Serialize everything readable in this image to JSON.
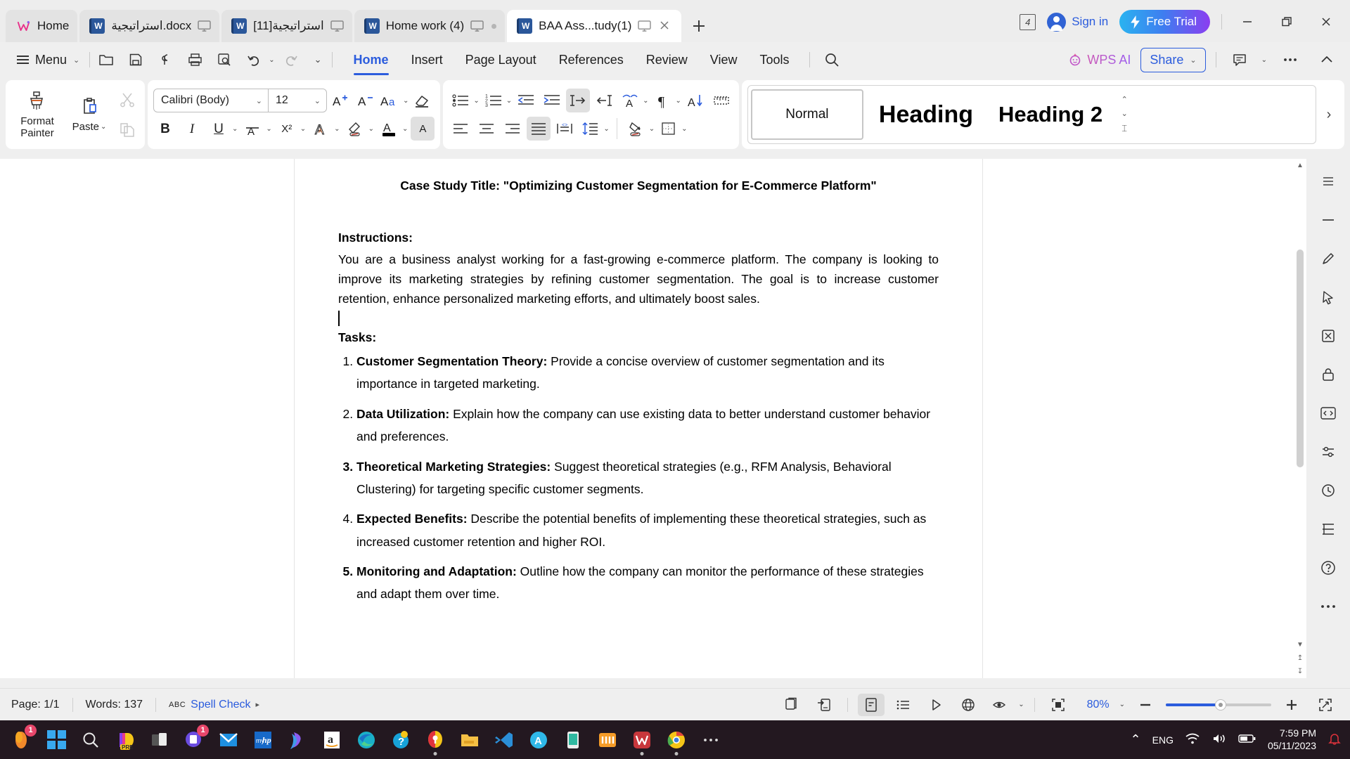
{
  "window": {
    "tabs": [
      {
        "label": "Home",
        "icon": "wps-home-icon",
        "type": "home",
        "active": false,
        "has_monitor": false,
        "has_close": false
      },
      {
        "label": "استراتيجية.docx",
        "icon": "word-doc-icon",
        "type": "doc",
        "active": false,
        "has_monitor": true,
        "has_close": false
      },
      {
        "label": "استراتيجية[11]",
        "icon": "word-doc-icon",
        "type": "doc",
        "active": false,
        "has_monitor": true,
        "has_close": false
      },
      {
        "label": "Home work (4)",
        "icon": "word-doc-icon",
        "type": "doc",
        "active": false,
        "has_monitor": true,
        "has_close": false,
        "has_dot": true
      },
      {
        "label": "BAA Ass...tudy(1)",
        "icon": "word-doc-icon",
        "type": "doc",
        "active": true,
        "has_monitor": true,
        "has_close": true
      }
    ],
    "new_tab_label": "+",
    "window_count_badge": "4",
    "sign_in_label": "Sign in",
    "free_trial_label": "Free Trial",
    "minimize_label": "—",
    "restore_label": "❐",
    "close_label": "✕",
    "accent_blue": "#2b5cdd"
  },
  "menubar": {
    "menu_label": "Menu",
    "quick_access": [
      "open-folder-icon",
      "save-icon",
      "cloud-sync-icon",
      "print-icon",
      "print-preview-icon",
      "undo-icon",
      "redo-icon",
      "customize-icon"
    ],
    "ribbon_tabs": [
      {
        "label": "Home",
        "active": true
      },
      {
        "label": "Insert",
        "active": false
      },
      {
        "label": "Page Layout",
        "active": false
      },
      {
        "label": "References",
        "active": false
      },
      {
        "label": "Review",
        "active": false
      },
      {
        "label": "View",
        "active": false
      },
      {
        "label": "Tools",
        "active": false
      }
    ],
    "search_icon": "search-icon",
    "wps_ai_label": "WPS AI",
    "share_label": "Share",
    "comment_icon": "comment-icon",
    "more_icon": "more-icon",
    "collapse_icon": "chevron-up-icon"
  },
  "toolbar": {
    "format_painter_label": "Format Painter",
    "paste_label": "Paste",
    "cut_label": "cut-icon",
    "copy_label": "copy-icon",
    "font_name": "Calibri (Body)",
    "font_size": "12",
    "grow_font": "A+",
    "shrink_font": "A-",
    "change_case": "Aa",
    "clear_format": "clear-formatting-icon",
    "bold": "B",
    "italic": "I",
    "underline": "U",
    "strikethrough": "A",
    "superscript": "X²",
    "text_effects": "A",
    "highlight": "highlight-icon",
    "font_color": "A",
    "char_shading": "A",
    "bullets": "bullet-list-icon",
    "numbering": "numbered-list-icon",
    "decrease_indent": "decrease-indent-icon",
    "increase_indent": "increase-indent-icon",
    "ltr_text": "left-to-right-icon",
    "rtl_text": "right-to-left-icon",
    "phonetic": "phonetic-guide-icon",
    "show_marks": "show-paragraph-marks-icon",
    "sort": "sort-icon",
    "borders_grid": "ruler-icon",
    "align_left": "align-left-icon",
    "align_center": "align-center-icon",
    "align_right": "align-right-icon",
    "align_justify": "align-justify-icon",
    "distribute": "distributed-align-icon",
    "line_spacing": "line-spacing-icon",
    "shading": "shading-icon",
    "borders": "borders-icon"
  },
  "styles": {
    "items": [
      {
        "label": "Normal",
        "selected": true
      },
      {
        "label": "Heading",
        "selected": false
      },
      {
        "label": "Heading 2",
        "selected": false
      }
    ],
    "scroll_up": "⌃",
    "scroll_down": "⌄",
    "more_styles": "≣",
    "expand_pane": "›"
  },
  "document": {
    "title": "Case Study Title: \"Optimizing Customer Segmentation for E-Commerce Platform\"",
    "instructions_heading": "Instructions:",
    "instructions_body": "You are a business analyst working for a fast-growing e-commerce platform. The company is looking to improve its marketing strategies by refining customer segmentation. The goal is to increase customer retention, enhance personalized marketing efforts, and ultimately boost sales.",
    "tasks_heading": "Tasks:",
    "tasks": [
      {
        "bold": "Customer Segmentation Theory:",
        "text": " Provide a concise overview of customer segmentation and its importance in targeted marketing.",
        "number_bold": false
      },
      {
        "bold": "Data Utilization:",
        "text": " Explain how the company can use existing data to better understand customer behavior and preferences.",
        "number_bold": false
      },
      {
        "bold": "Theoretical Marketing Strategies:",
        "text": " Suggest theoretical strategies (e.g., RFM Analysis, Behavioral Clustering) for targeting specific customer segments.",
        "number_bold": true
      },
      {
        "bold": "Expected Benefits:",
        "text": " Describe the potential benefits of implementing these theoretical strategies, such as increased customer retention and higher ROI.",
        "number_bold": false
      },
      {
        "bold": "Monitoring and Adaptation:",
        "text": " Outline how the company can monitor the performance of these strategies and adapt them over time.",
        "number_bold": true
      }
    ]
  },
  "right_rail": {
    "items": [
      "expand-rail-icon",
      "collapse-rail-icon",
      "pen-icon",
      "select-cursor-icon",
      "crop-icon",
      "lock-icon",
      "code-icon",
      "settings-sliders-icon",
      "history-icon",
      "layout-icon",
      "help-icon",
      "more-tools-icon"
    ]
  },
  "status_bar": {
    "page": "Page: 1/1",
    "words": "Words: 137",
    "spell_check": "Spell Check",
    "spell_icon": "ABC",
    "view_buttons": [
      {
        "name": "page-layout-view",
        "icon": "⧉",
        "active": false
      },
      {
        "name": "read-mode-view",
        "icon": "⇥",
        "active": false
      },
      {
        "name": "web-layout-view",
        "icon": "▤",
        "active": true
      },
      {
        "name": "outline-view",
        "icon": "≣",
        "active": false
      },
      {
        "name": "presentation-view",
        "icon": "▷",
        "active": false
      },
      {
        "name": "web-view",
        "icon": "⊕",
        "active": false
      },
      {
        "name": "display-options",
        "icon": "◉",
        "active": false
      }
    ],
    "fit_page_icon": "fit-page-icon",
    "zoom_level": "80%",
    "zoom_out": "—",
    "zoom_in": "+",
    "fullscreen_icon": "fullscreen-icon"
  },
  "taskbar": {
    "icons": [
      {
        "name": "firefox-icon",
        "badge": "1"
      },
      {
        "name": "windows-start-icon",
        "badge": null
      },
      {
        "name": "search-icon",
        "badge": null
      },
      {
        "name": "copilot-pre-icon",
        "badge": null
      },
      {
        "name": "task-view-icon",
        "badge": null
      },
      {
        "name": "teams-chat-icon",
        "badge": "1"
      },
      {
        "name": "mail-icon",
        "badge": null
      },
      {
        "name": "myhp-icon",
        "badge": null
      },
      {
        "name": "designer-icon",
        "badge": null
      },
      {
        "name": "amazon-icon",
        "badge": null
      },
      {
        "name": "edge-icon",
        "badge": null
      },
      {
        "name": "support-assistant-icon",
        "badge": null
      },
      {
        "name": "security-icon",
        "badge": null,
        "running": true
      },
      {
        "name": "file-explorer-icon",
        "badge": null
      },
      {
        "name": "vscode-icon",
        "badge": null
      },
      {
        "name": "autodesk-icon",
        "badge": null
      },
      {
        "name": "phone-link-icon",
        "badge": null
      },
      {
        "name": "wechat-icon",
        "badge": null
      },
      {
        "name": "wps-office-icon",
        "badge": null,
        "running": true
      },
      {
        "name": "chrome-icon",
        "badge": null,
        "running": true
      },
      {
        "name": "show-hidden-icons",
        "badge": null
      }
    ],
    "tray_chevron": "⌃",
    "language": "ENG",
    "wifi_icon": "wifi-icon",
    "volume_icon": "volume-icon",
    "battery_icon": "battery-icon",
    "time": "7:59 PM",
    "date": "05/11/2023",
    "notification_icon": "bell-icon"
  }
}
